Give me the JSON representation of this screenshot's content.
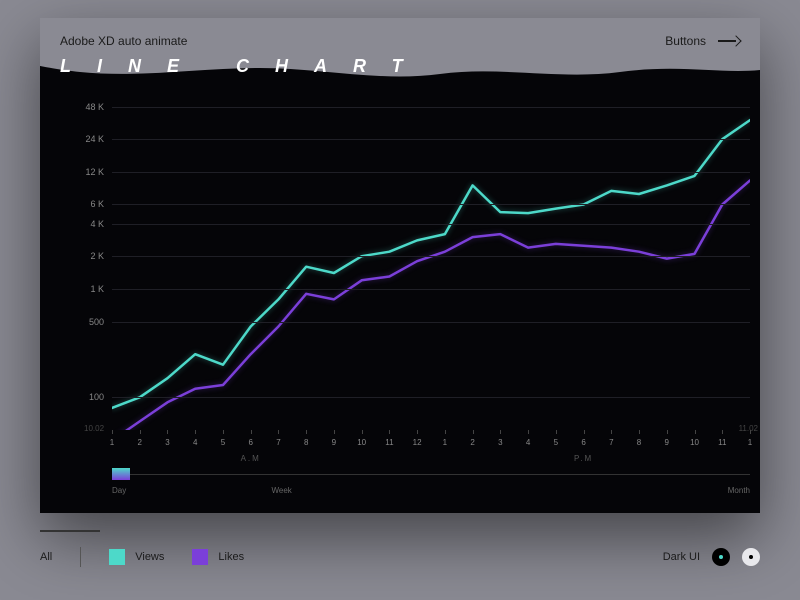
{
  "header": {
    "left": "Adobe XD auto animate",
    "right": "Buttons"
  },
  "title": "LINE CHART",
  "colors": {
    "views": "#4dd9c9",
    "likes": "#7b3fd9"
  },
  "y_ticks": [
    "48 K",
    "24 K",
    "12 K",
    "6 K",
    "4 K",
    "2 K",
    "1 K",
    "500",
    "100"
  ],
  "x_ticks": [
    "1",
    "2",
    "3",
    "4",
    "5",
    "6",
    "7",
    "8",
    "9",
    "10",
    "11",
    "12",
    "1",
    "2",
    "3",
    "4",
    "5",
    "6",
    "7",
    "8",
    "9",
    "10",
    "11",
    "1"
  ],
  "x_periods": {
    "am": "A.M",
    "pm": "P.M"
  },
  "x_dates": {
    "start": "10.02",
    "end": "11.02"
  },
  "timeline": {
    "day": "Day",
    "week": "Week",
    "month": "Month"
  },
  "legend": {
    "all": "All",
    "views": "Views",
    "likes": "Likes"
  },
  "theme": {
    "label": "Dark UI"
  },
  "chart_data": {
    "type": "line",
    "x": [
      1,
      2,
      3,
      4,
      5,
      6,
      7,
      8,
      9,
      10,
      11,
      12,
      13,
      14,
      15,
      16,
      17,
      18,
      19,
      20,
      21,
      22,
      23,
      24
    ],
    "x_labels": [
      "1",
      "2",
      "3",
      "4",
      "5",
      "6",
      "7",
      "8",
      "9",
      "10",
      "11",
      "12",
      "1",
      "2",
      "3",
      "4",
      "5",
      "6",
      "7",
      "8",
      "9",
      "10",
      "11",
      "1"
    ],
    "series": [
      {
        "name": "Views",
        "values": [
          80,
          100,
          150,
          250,
          200,
          450,
          800,
          1600,
          1400,
          2000,
          2200,
          2800,
          3200,
          9000,
          5100,
          5000,
          5500,
          6000,
          8000,
          7500,
          9000,
          11000,
          24000,
          36000
        ]
      },
      {
        "name": "Likes",
        "values": [
          40,
          60,
          90,
          120,
          130,
          250,
          450,
          900,
          800,
          1200,
          1300,
          1800,
          2200,
          3000,
          3200,
          2400,
          2600,
          2500,
          2400,
          2200,
          1900,
          2100,
          6000,
          10000
        ]
      }
    ],
    "yscale": "log",
    "ylim": [
      50,
      60000
    ],
    "y_tick_values": [
      48000,
      24000,
      12000,
      6000,
      4000,
      2000,
      1000,
      500,
      100
    ],
    "xlabel": "",
    "ylabel": "",
    "title": "LINE CHART",
    "x_range_label": "10.02 – 11.02",
    "x_period_split": {
      "am_end_index": 11,
      "am_label": "A.M",
      "pm_label": "P.M"
    }
  }
}
